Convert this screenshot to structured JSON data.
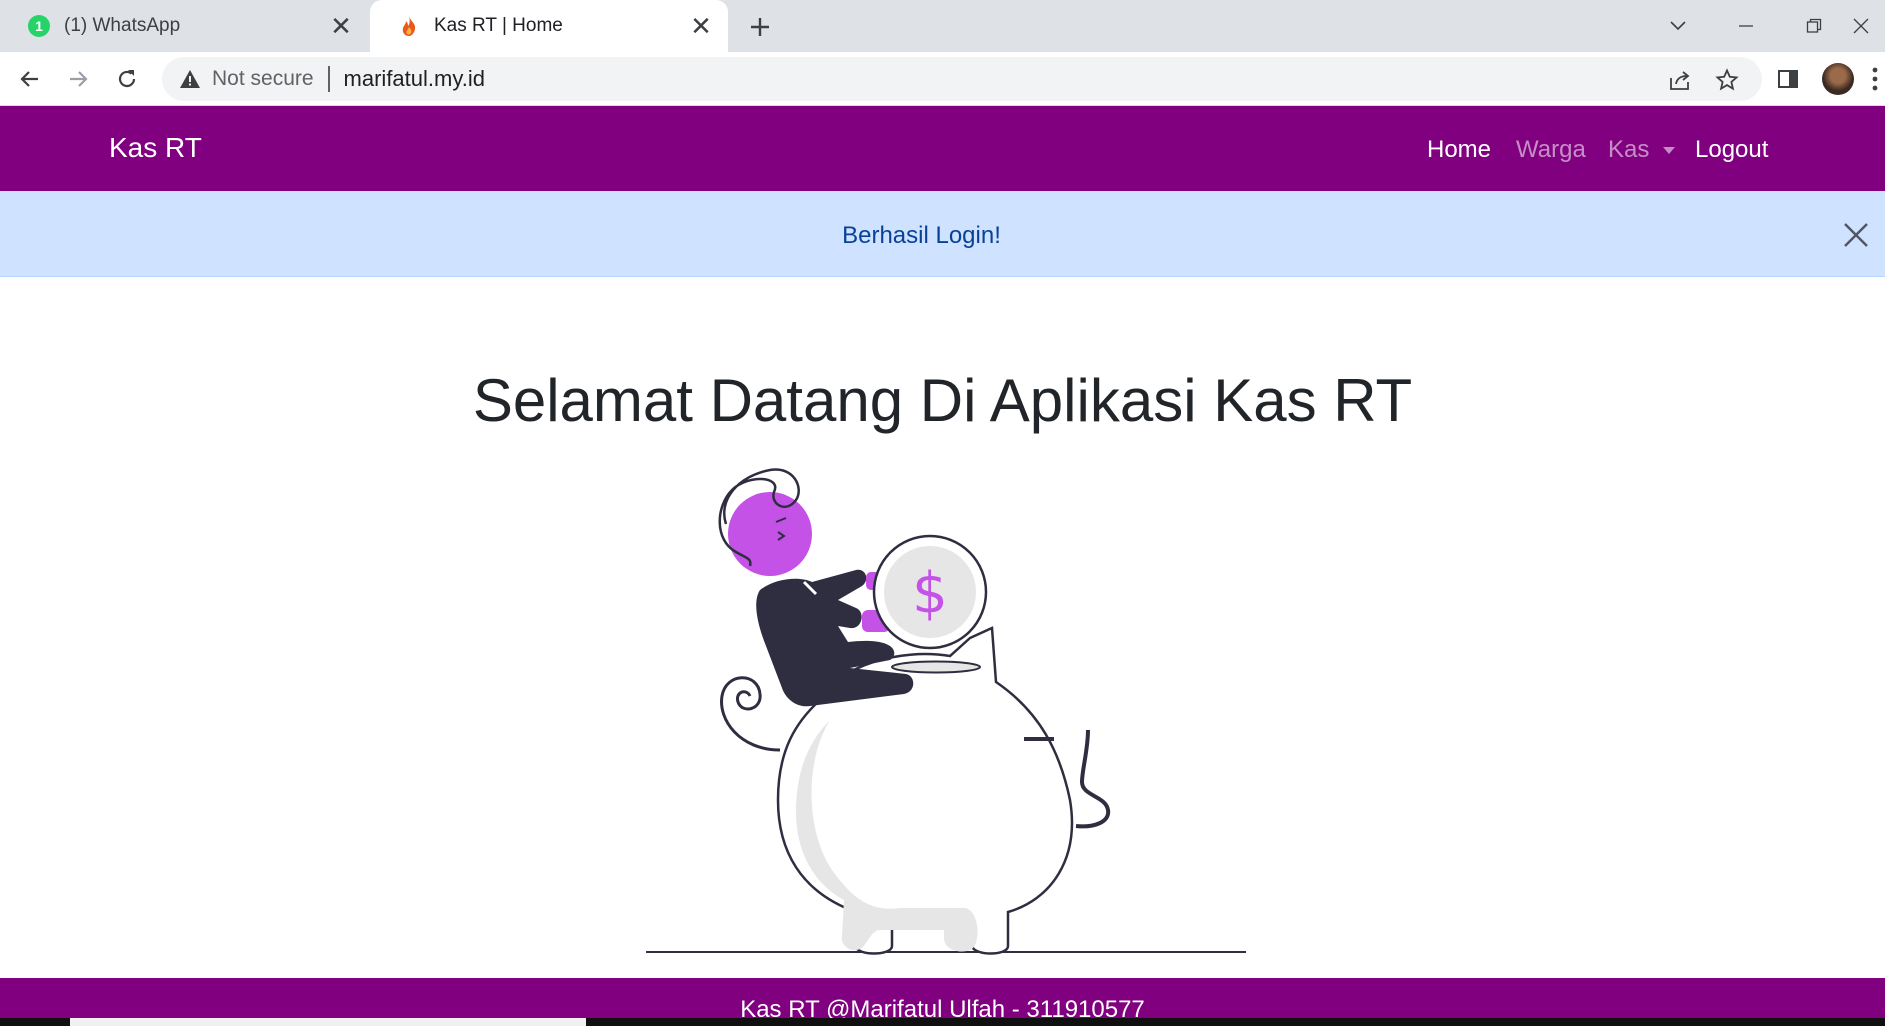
{
  "browser": {
    "tabs": [
      {
        "badge": "1",
        "title": "(1) WhatsApp"
      },
      {
        "title": "Kas RT | Home"
      }
    ],
    "address": {
      "security_label": "Not secure",
      "url": "marifatul.my.id"
    }
  },
  "navbar": {
    "brand": "Kas RT",
    "links": {
      "home": "Home",
      "warga": "Warga",
      "kas": "Kas",
      "logout": "Logout"
    }
  },
  "alert": {
    "message": "Berhasil Login!"
  },
  "main": {
    "headline": "Selamat Datang Di Aplikasi Kas RT",
    "coin_symbol": "$"
  },
  "footer": {
    "text": "Kas RT @Marifatul Ulfah - 311910577"
  },
  "colors": {
    "navbar_bg": "#800080",
    "alert_bg": "#cfe2ff",
    "alert_text": "#084298",
    "illustration_accent": "#c452e6",
    "illustration_dark": "#2f2e41"
  },
  "icons": {
    "tab_whatsapp": "whatsapp-icon",
    "tab_kas": "flame-icon",
    "back": "arrow-left-icon",
    "forward": "arrow-right-icon",
    "reload": "reload-icon",
    "security": "warning-triangle-icon",
    "share": "share-icon",
    "bookmark": "star-icon",
    "side_panel": "side-panel-icon",
    "alert_close": "close-icon"
  }
}
